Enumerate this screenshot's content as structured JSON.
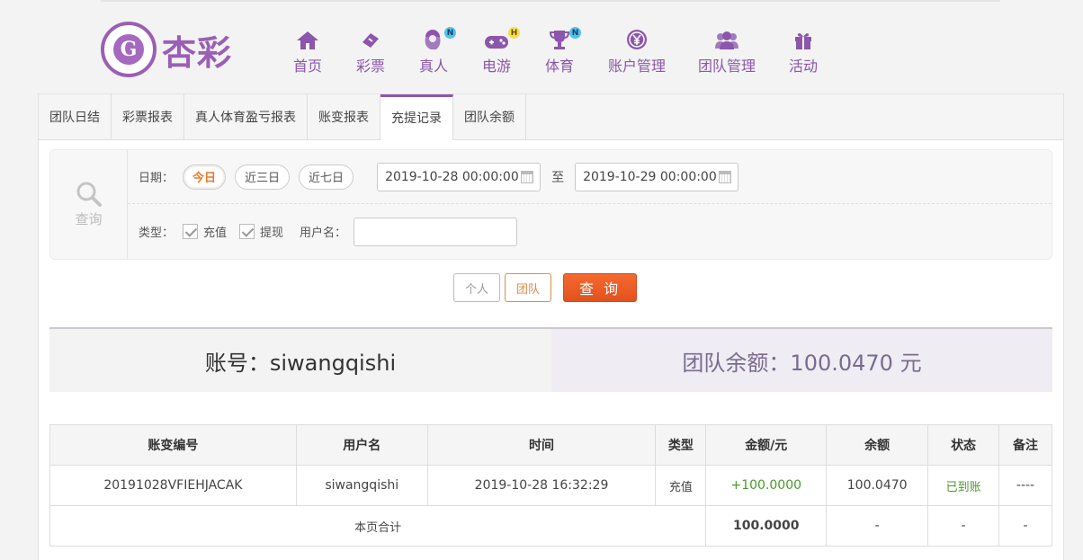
{
  "logo": {
    "mark": "G",
    "text": "杏彩"
  },
  "nav": [
    {
      "label": "首页",
      "icon": "home-icon",
      "badge": ""
    },
    {
      "label": "彩票",
      "icon": "lottery-ticket-icon",
      "badge": ""
    },
    {
      "label": "真人",
      "icon": "live-dealer-icon",
      "badge": "N"
    },
    {
      "label": "电游",
      "icon": "gamepad-icon",
      "badge": "H"
    },
    {
      "label": "体育",
      "icon": "trophy-icon",
      "badge": "N"
    },
    {
      "label": "账户管理",
      "icon": "yen-coin-icon",
      "badge": ""
    },
    {
      "label": "团队管理",
      "icon": "team-users-icon",
      "badge": ""
    },
    {
      "label": "活动",
      "icon": "gift-icon",
      "badge": ""
    }
  ],
  "tabs": [
    "团队日结",
    "彩票报表",
    "真人体育盈亏报表",
    "账变报表",
    "充提记录",
    "团队余额"
  ],
  "active_tab": "充提记录",
  "filter": {
    "side_label": "查询",
    "date_label": "日期：",
    "quick": [
      "今日",
      "近三日",
      "近七日"
    ],
    "start": "2019-10-28 00:00:00",
    "to": "至",
    "end": "2019-10-29 00:00:00",
    "type_label": "类型：",
    "types": [
      "充值",
      "提现"
    ],
    "username_label": "用户名：",
    "username_value": ""
  },
  "buttons": {
    "personal": "个人",
    "team": "团队",
    "query": "查 询"
  },
  "summary": {
    "account": "账号：siwangqishi",
    "team_balance": "团队余额：100.0470 元"
  },
  "table": {
    "headers": [
      "账变编号",
      "用户名",
      "时间",
      "类型",
      "金额/元",
      "余额",
      "状态",
      "备注"
    ],
    "rows": [
      {
        "id": "20191028VFIEHJACAK",
        "user": "siwangqishi",
        "time": "2019-10-28 16:32:29",
        "type": "充值",
        "amount": "+100.0000",
        "balance": "100.0470",
        "status": "已到账",
        "note": "----"
      }
    ],
    "total": {
      "label": "本页合计",
      "amount": "100.0000",
      "balance": "-",
      "status": "-",
      "note": "-"
    }
  },
  "colors": {
    "brand": "#8b56ac",
    "accent": "#e2511d",
    "success": "#4a9a2a"
  }
}
